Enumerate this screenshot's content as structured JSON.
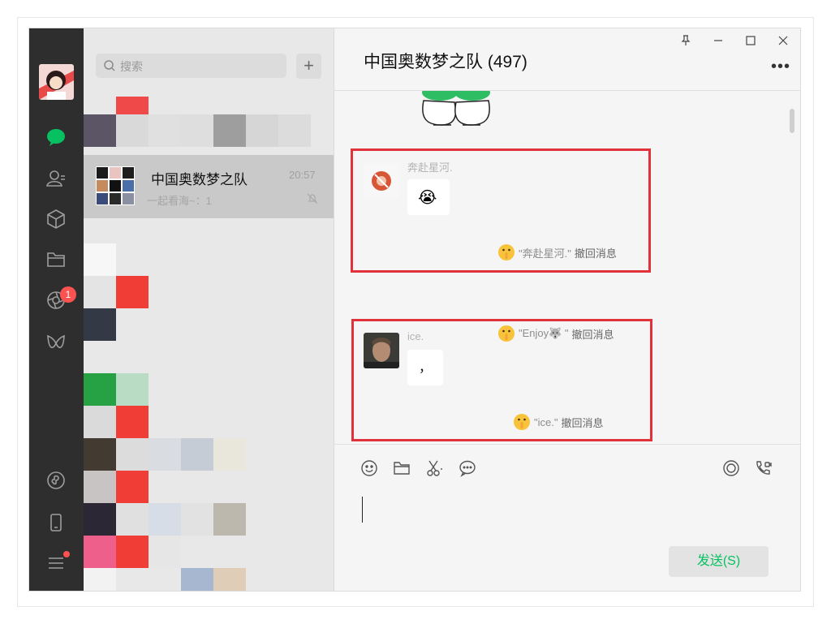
{
  "window": {
    "title": "中国奥数梦之队 (497)",
    "controls": [
      "pin-icon",
      "minimize-icon",
      "maximize-icon",
      "close-icon"
    ],
    "more_label": "•••"
  },
  "nav": {
    "items": [
      "chat-icon",
      "contacts-icon",
      "favorites-icon",
      "files-icon",
      "moments-icon",
      "channels-icon",
      "mini-programs-icon",
      "phone-icon",
      "menu-icon"
    ],
    "moments_badge": "1",
    "accent": "#07c160"
  },
  "search": {
    "placeholder": "搜索",
    "add_label": "+"
  },
  "conversation": {
    "name": "中国奥数梦之队",
    "time": "20:57",
    "preview": "一起看海~：1",
    "muted": true
  },
  "messages": [
    {
      "sender": "奔赴星河.",
      "content": "😭",
      "recall_prefix": "\"奔赴星河.\"",
      "recall_text": "撤回消息",
      "highlighted": true
    },
    {
      "sender": "",
      "content": "",
      "recall_prefix": "\"Enjoy🐺 \"",
      "recall_text": "撤回消息",
      "highlighted": false
    },
    {
      "sender": "ice.",
      "content": "，",
      "recall_prefix": "\"ice.\"",
      "recall_text": "撤回消息",
      "highlighted": true
    }
  ],
  "input": {
    "tools": [
      "emoji-icon",
      "folder-icon",
      "scissors-icon",
      "chat-record-icon"
    ],
    "right_tools": [
      "live-icon",
      "call-icon"
    ],
    "send_label": "发送(S)"
  },
  "colors": {
    "highlight_border": "#e1323c",
    "send_text": "#07c160",
    "badge": "#fa5151"
  }
}
